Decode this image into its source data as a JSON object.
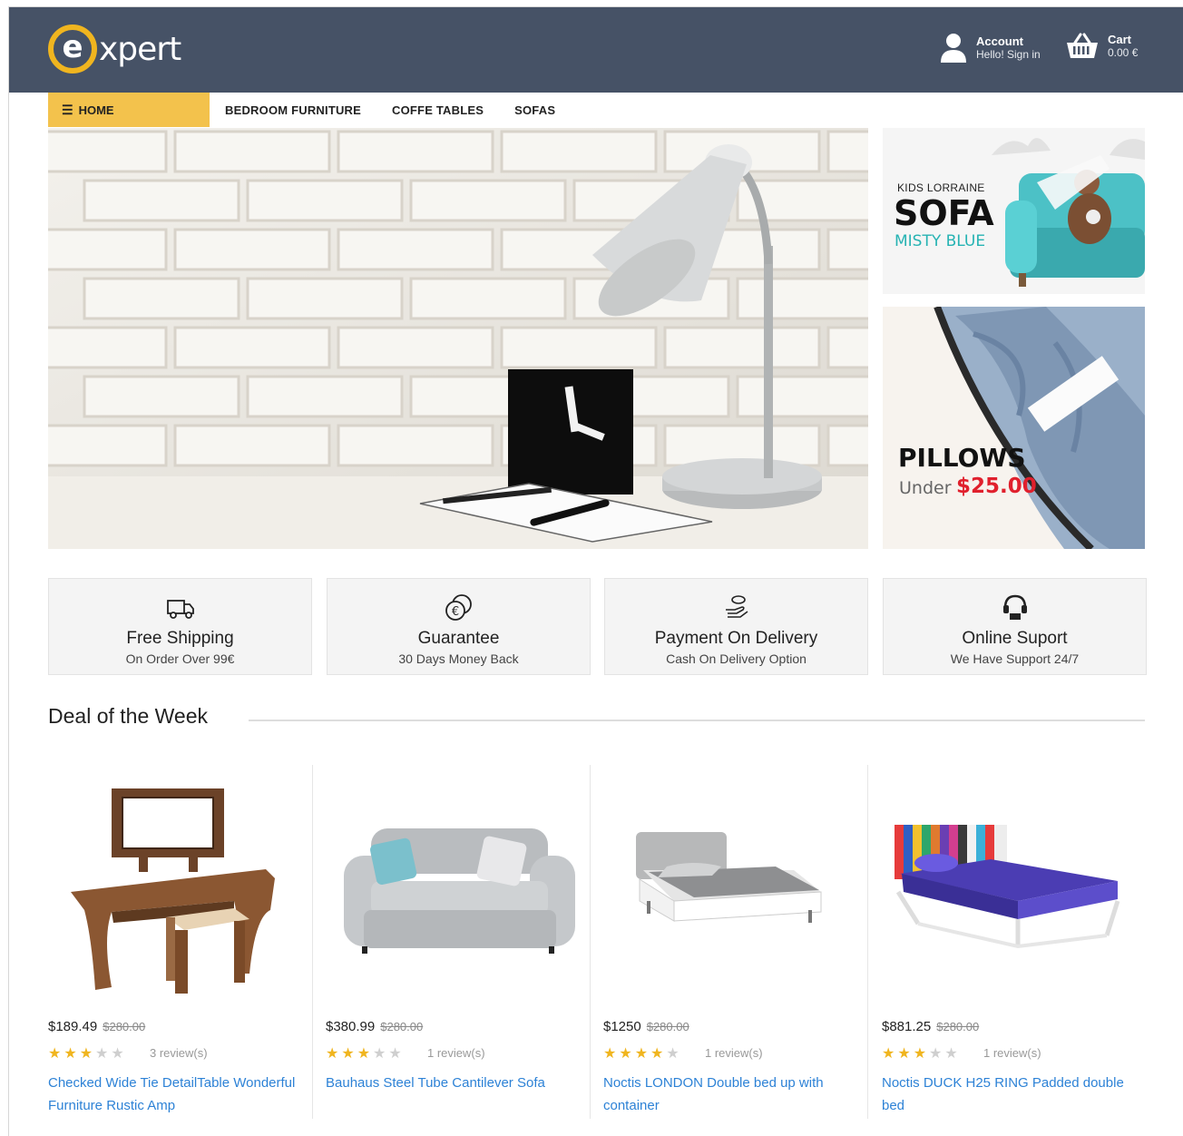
{
  "logo": {
    "letter": "e",
    "text": "xpert"
  },
  "header": {
    "account": {
      "title": "Account",
      "subtitle": "Hello! Sign in",
      "icon": "user-icon"
    },
    "cart": {
      "title": "Cart",
      "subtitle": "0.00 €",
      "icon": "basket-icon"
    }
  },
  "nav": {
    "home": "HOME",
    "links": [
      "BEDROOM FURNITURE",
      "COFFE TABLES",
      "SOFAS"
    ]
  },
  "banners": {
    "sofa": {
      "small": "KIDS LORRAINE",
      "big": "SOFA",
      "color": "MISTY BLUE"
    },
    "pillows": {
      "big": "PILLOWS",
      "under": "Under",
      "price": "$25.00"
    }
  },
  "features": [
    {
      "title": "Free Shipping",
      "subtitle": "On Order Over 99€",
      "icon": "truck-icon"
    },
    {
      "title": "Guarantee",
      "subtitle": "30 Days Money Back",
      "icon": "coins-icon"
    },
    {
      "title": "Payment On Delivery",
      "subtitle": "Cash On Delivery Option",
      "icon": "hand-money-icon"
    },
    {
      "title": "Online Suport",
      "subtitle": "We Have Support 24/7",
      "icon": "headset-icon"
    }
  ],
  "deal": {
    "title": "Deal of the Week",
    "products": [
      {
        "price": "$189.49",
        "old_price": "$280.00",
        "rating": 3,
        "reviews": "3 review(s)",
        "name": "Checked Wide Tie DetailTable Wonderful Furniture Rustic Amp"
      },
      {
        "price": "$380.99",
        "old_price": "$280.00",
        "rating": 3,
        "reviews": "1 review(s)",
        "name": "Bauhaus Steel Tube Cantilever Sofa"
      },
      {
        "price": "$1250",
        "old_price": "$280.00",
        "rating": 4,
        "reviews": "1 review(s)",
        "name": "Noctis LONDON Double bed up with container"
      },
      {
        "price": "$881.25",
        "old_price": "$280.00",
        "rating": 3,
        "reviews": "1 review(s)",
        "name": "Noctis DUCK H25 RING Padded double bed"
      }
    ]
  },
  "colors": {
    "header_bg": "#465266",
    "accent": "#f3c24c",
    "link": "#2d82d6",
    "sale": "#e0202d"
  }
}
